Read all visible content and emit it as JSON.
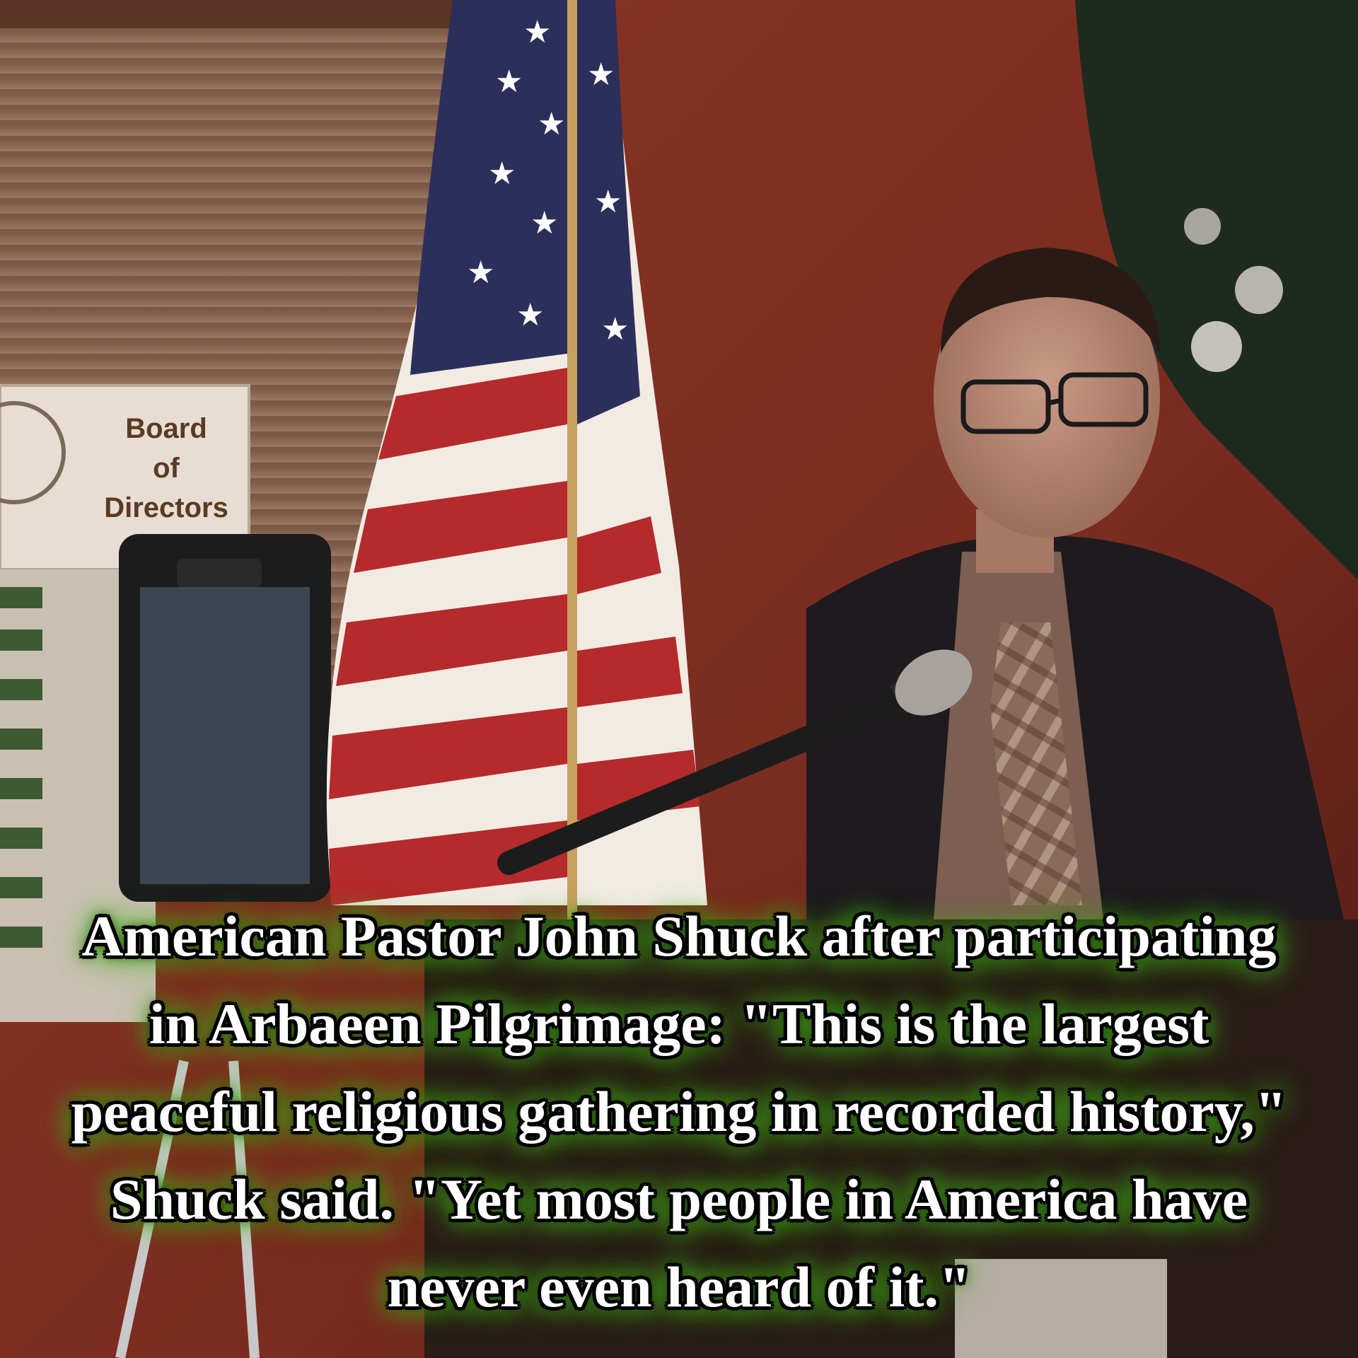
{
  "photo": {
    "sign": {
      "lines": [
        "Board",
        "of",
        "Directors"
      ]
    },
    "caption": {
      "lines": [
        "American Pastor John Shuck after participating",
        "in Arbaeen Pilgrimage:  \"This is the largest",
        "peaceful religious gathering in recorded history,\"",
        "Shuck said. \"Yet most people in America have",
        "never even heard of it.\""
      ]
    },
    "colors": {
      "wall": "#7a2e22",
      "caption_glow": "#5fd92b",
      "caption_text": "#ffffff"
    }
  }
}
